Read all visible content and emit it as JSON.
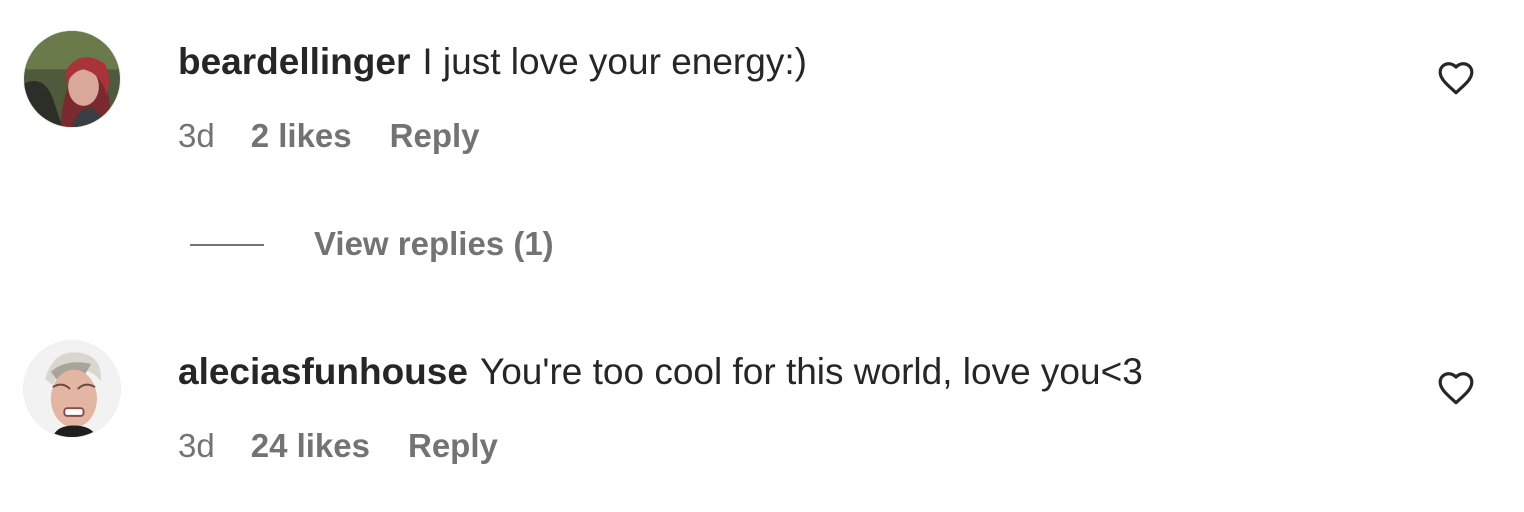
{
  "comments": [
    {
      "username": "beardellinger",
      "text": "I just love your energy:)",
      "time": "3d",
      "likes": "2 likes",
      "reply_label": "Reply",
      "avatar_icon": "avatar-photo-red-hair",
      "like_icon": "heart-outline-icon"
    },
    {
      "username": "aleciasfunhouse",
      "text": "You're too cool for this world, love you<3",
      "time": "3d",
      "likes": "24 likes",
      "reply_label": "Reply",
      "avatar_icon": "avatar-photo-blonde-short-hair",
      "like_icon": "heart-outline-icon"
    }
  ],
  "view_replies": {
    "label": "View replies (1)"
  },
  "colors": {
    "primary_text": "#262626",
    "secondary_text": "#737373",
    "background": "#ffffff"
  }
}
